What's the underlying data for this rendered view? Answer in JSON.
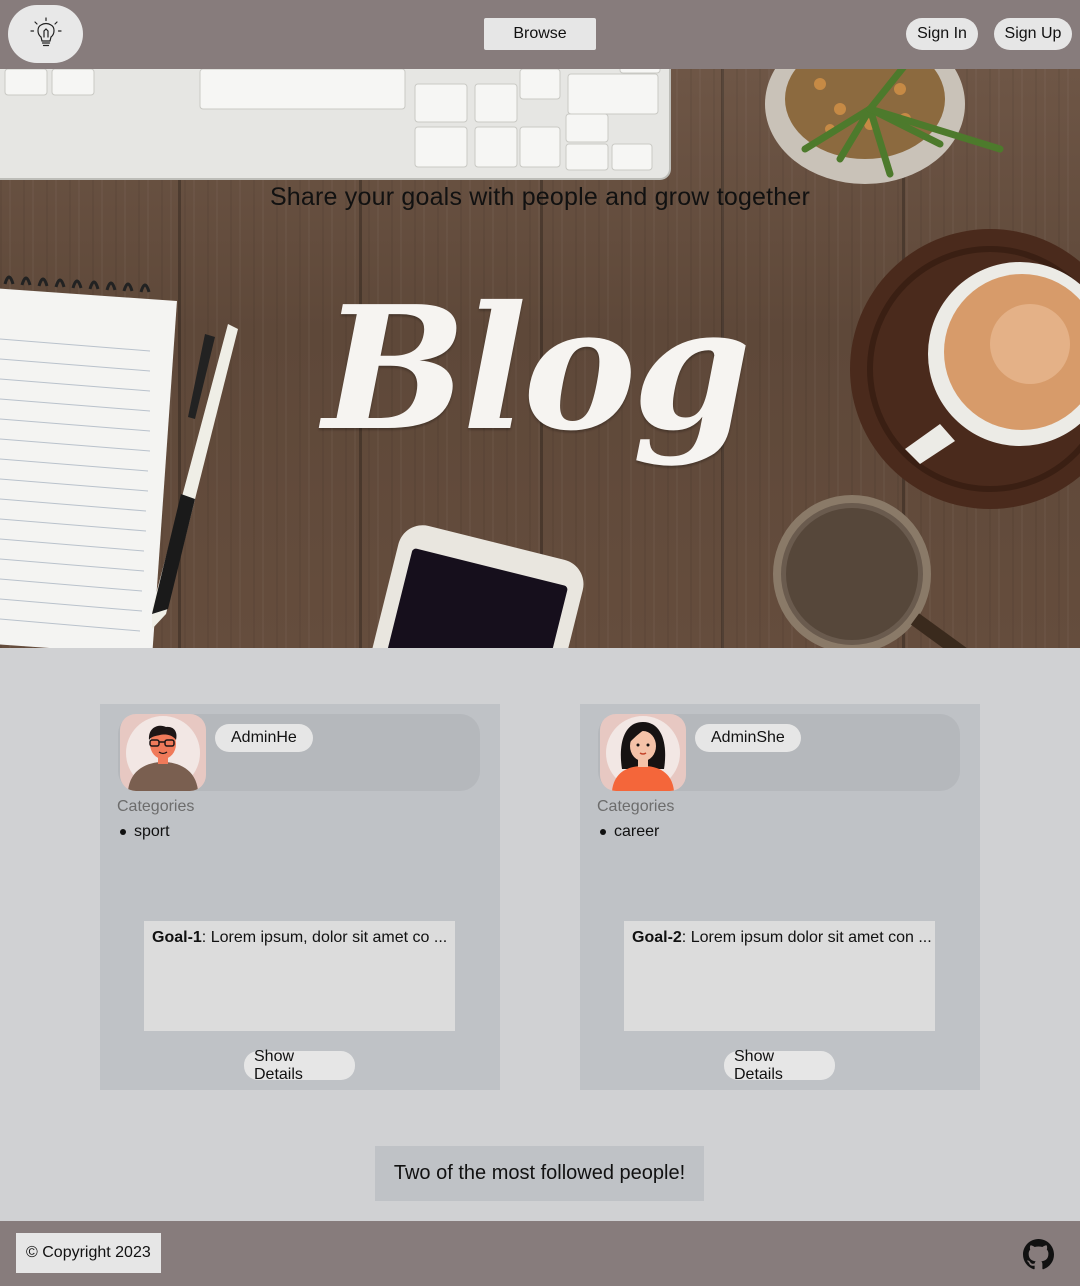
{
  "header": {
    "logo_icon": "lightbulb-icon",
    "browse_label": "Browse",
    "sign_in_label": "Sign In",
    "sign_up_label": "Sign Up"
  },
  "hero": {
    "tagline": "Share your goals with people and grow together",
    "title": "Blog"
  },
  "cards": [
    {
      "author": "AdminHe",
      "categories_label": "Categories",
      "categories": [
        "sport"
      ],
      "goal_title": "Goal-1",
      "goal_text": ": Lorem ipsum, dolor sit amet co ...",
      "details_label": "Show Details"
    },
    {
      "author": "AdminShe",
      "categories_label": "Categories",
      "categories": [
        "career"
      ],
      "goal_title": "Goal-2",
      "goal_text": ": Lorem ipsum dolor sit amet con ...",
      "details_label": "Show Details"
    }
  ],
  "followed_banner": "Two of the most followed people!",
  "footer": {
    "copyright": "© Copyright 2023",
    "github_icon": "github-icon"
  },
  "colors": {
    "navbar": "#877c7c",
    "page_bg": "#d0d1d3",
    "card_bg": "#bfc2c6",
    "button_bg": "#e6e6e6"
  }
}
